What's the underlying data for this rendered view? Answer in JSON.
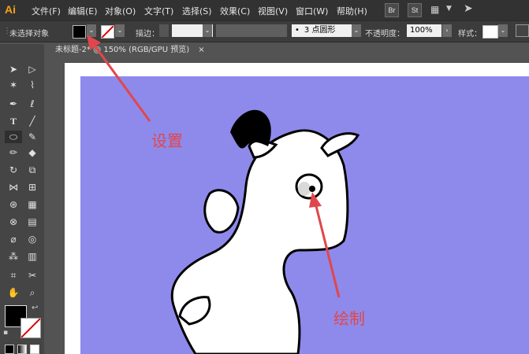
{
  "app": {
    "logo": "Ai"
  },
  "menu": [
    "文件(F)",
    "编辑(E)",
    "对象(O)",
    "文字(T)",
    "选择(S)",
    "效果(C)",
    "视图(V)",
    "窗口(W)",
    "帮助(H)"
  ],
  "app_buttons": [
    "Br",
    "St"
  ],
  "control_bar": {
    "selection_label": "未选择对象",
    "stroke_label": "描边：",
    "point_value": "3 点圆形",
    "opacity_label": "不透明度：",
    "opacity_value": "100%",
    "style_label": "样式："
  },
  "document_tab": {
    "title": "未标题-2* @ 150% (RGB/GPU 预览)",
    "close": "×"
  },
  "annotations": {
    "setting": "设置",
    "draw": "绘制"
  },
  "colors": {
    "artboard": "#8e8aeb",
    "annotation": "#e0474c",
    "fill": "#000000"
  }
}
